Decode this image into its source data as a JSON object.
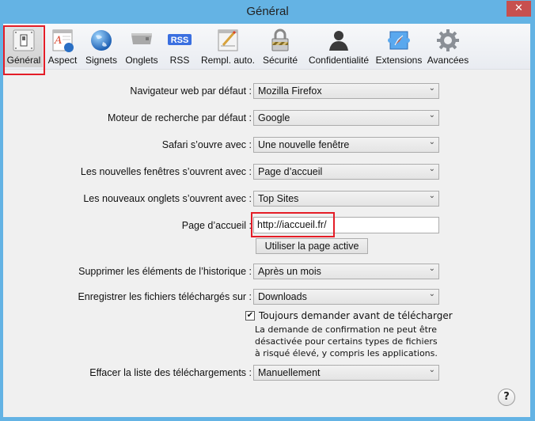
{
  "window": {
    "title": "Général",
    "close_symbol": "✕"
  },
  "toolbar": {
    "items": [
      {
        "label": "Général",
        "icon": "switch-icon",
        "selected": true
      },
      {
        "label": "Aspect",
        "icon": "appearance-icon"
      },
      {
        "label": "Signets",
        "icon": "globe-icon"
      },
      {
        "label": "Onglets",
        "icon": "tabs-icon"
      },
      {
        "label": "RSS",
        "icon": "rss-icon",
        "icon_text": "RSS"
      },
      {
        "label": "Rempl. auto.",
        "icon": "autofill-pencil-icon"
      },
      {
        "label": "Sécurité",
        "icon": "padlock-icon"
      },
      {
        "label": "Confidentialité",
        "icon": "person-silhouette-icon"
      },
      {
        "label": "Extensions",
        "icon": "puzzle-compass-icon"
      },
      {
        "label": "Avancées",
        "icon": "gear-icon"
      }
    ]
  },
  "form": {
    "default_browser": {
      "label": "Navigateur web par défaut :",
      "value": "Mozilla Firefox"
    },
    "default_search": {
      "label": "Moteur de recherche par défaut :",
      "value": "Google"
    },
    "safari_opens_with": {
      "label": "Safari s’ouvre avec :",
      "value": "Une nouvelle fenêtre"
    },
    "new_windows_open_with": {
      "label": "Les nouvelles fenêtres s’ouvrent avec :",
      "value": "Page d’accueil"
    },
    "new_tabs_open_with": {
      "label": "Les nouveaux onglets s’ouvrent avec :",
      "value": "Top Sites"
    },
    "homepage": {
      "label": "Page d’accueil :",
      "value": "http://iaccueil.fr/"
    },
    "use_current_page_button": "Utiliser la page active",
    "remove_history": {
      "label": "Supprimer les éléments de l’historique :",
      "value": "Après un mois"
    },
    "save_downloads_to": {
      "label": "Enregistrer les fichiers téléchargés sur :",
      "value": "Downloads"
    },
    "ask_before_download": {
      "label": "Toujours demander avant de télécharger",
      "checked": true,
      "check_symbol": "✔"
    },
    "note": "La demande de confirmation ne peut être désactivée pour certains types de fichiers à risqué élevé, y compris les applications.",
    "clear_downloads": {
      "label": "Effacer la liste des téléchargements :",
      "value": "Manuellement"
    }
  },
  "dropdown_chevron": "⌄",
  "help_symbol": "?",
  "highlight_color": "#e41d27"
}
